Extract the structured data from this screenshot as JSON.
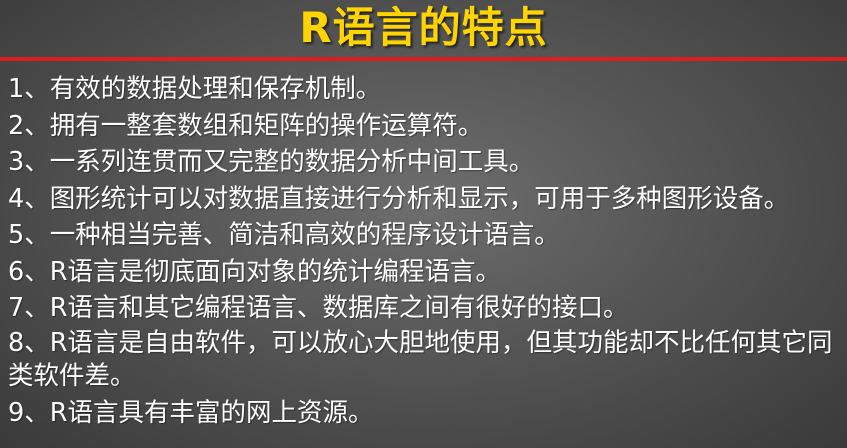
{
  "slide": {
    "title": "R语言的特点",
    "items": [
      "1、有效的数据处理和保存机制。",
      "2、拥有一整套数组和矩阵的操作运算符。",
      "3、一系列连贯而又完整的数据分析中间工具。",
      "4、图形统计可以对数据直接进行分析和显示，可用于多种图形设备。",
      "5、一种相当完善、简洁和高效的程序设计语言。",
      "6、R语言是彻底面向对象的统计编程语言。",
      "7、R语言和其它编程语言、数据库之间有很好的接口。",
      "8、R语言是自由软件，可以放心大胆地使用，但其功能却不比任何其它同类软件差。",
      "9、R语言具有丰富的网上资源。"
    ]
  },
  "colors": {
    "title": "#ffd400",
    "rule": "#d92020",
    "text": "#ffffff",
    "background": "#555555"
  }
}
